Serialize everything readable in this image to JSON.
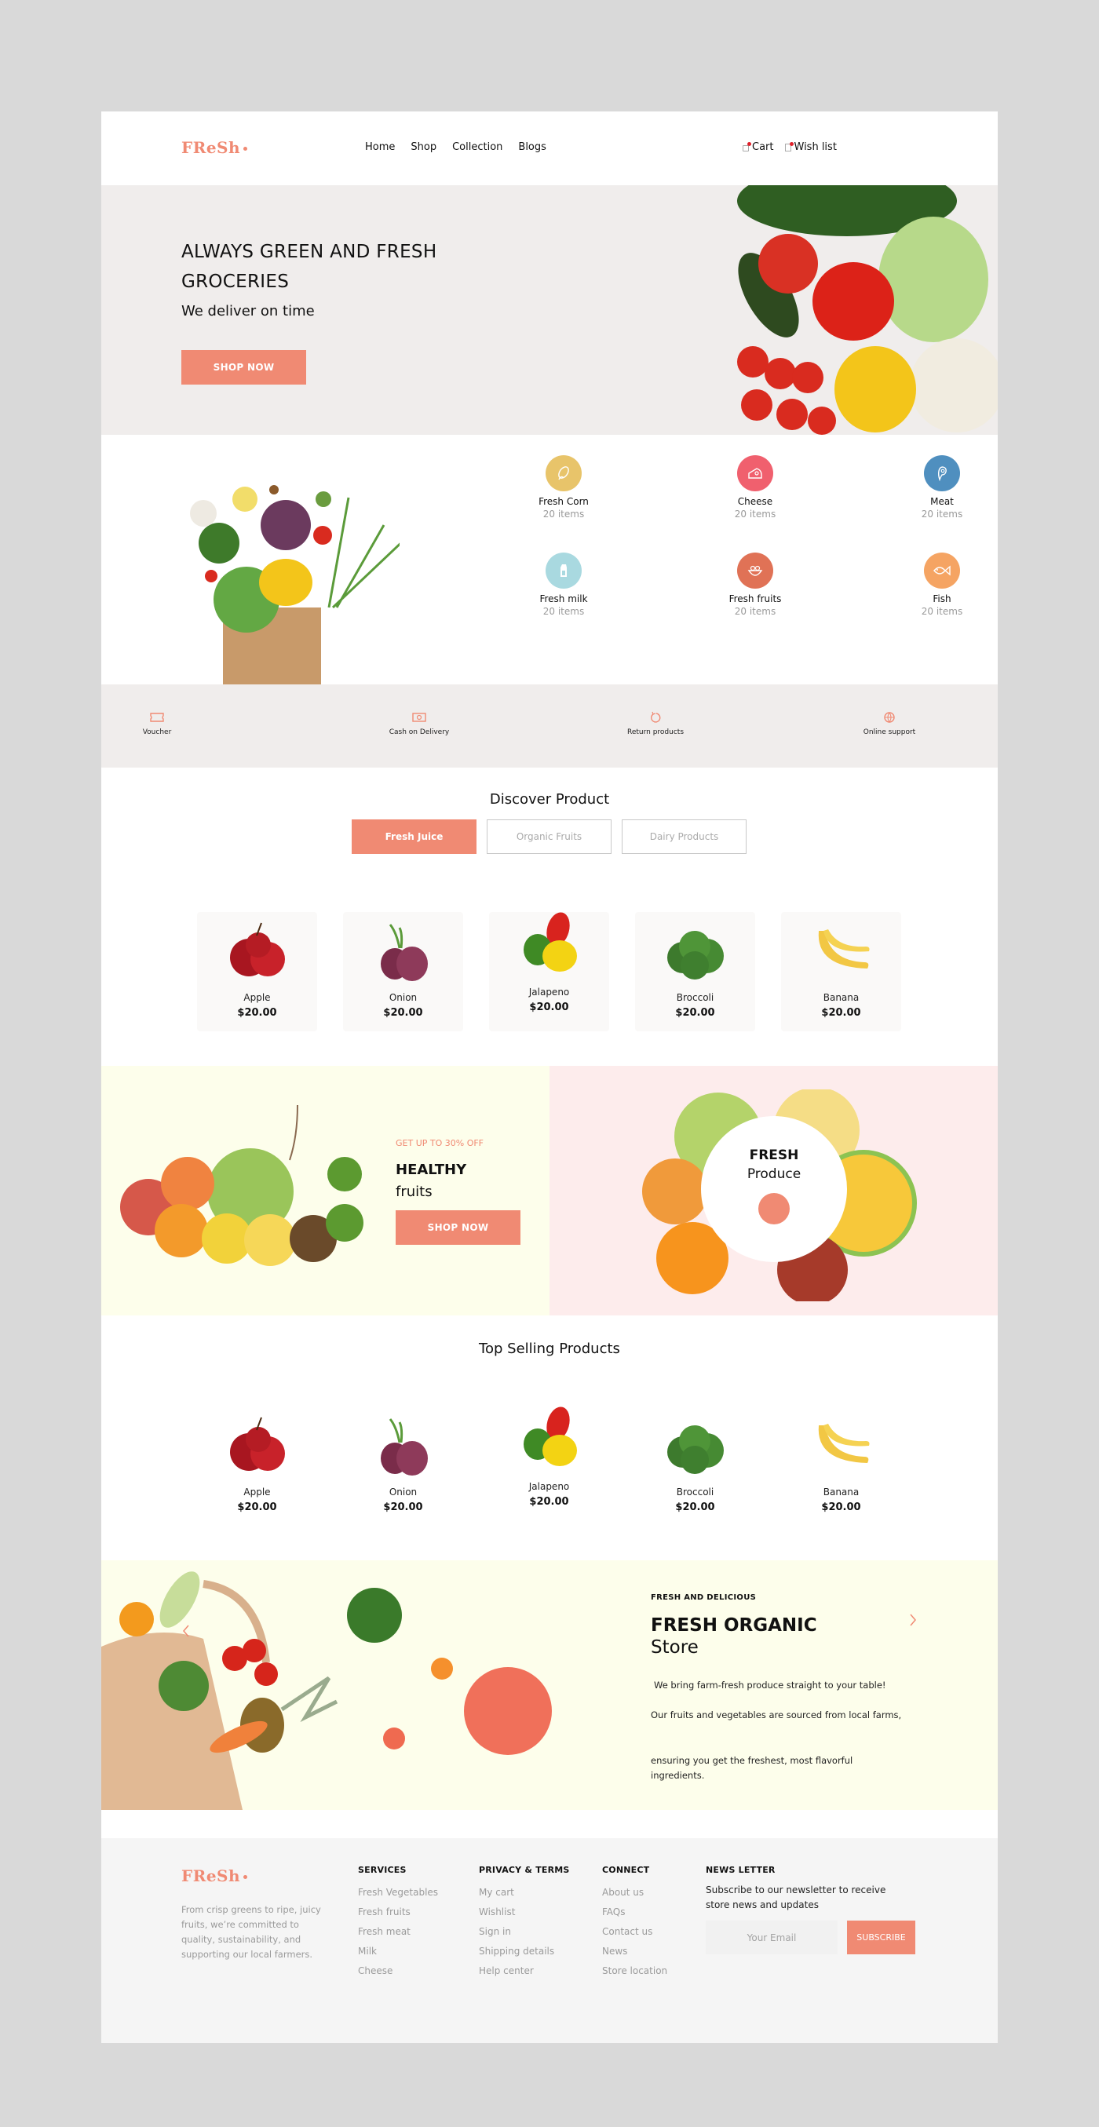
{
  "brand": {
    "logo_text": "FReSh",
    "accent_color": "#f08a73"
  },
  "nav": {
    "links": [
      "Home",
      "Shop",
      "Collection",
      "Blogs"
    ],
    "cart_label": "Cart",
    "wishlist_label": "Wish list"
  },
  "hero": {
    "headline": "ALWAYS GREEN AND FRESH GROCERIES",
    "subheadline": "We deliver on time",
    "cta_label": "SHOP NOW"
  },
  "categories": [
    {
      "name": "Fresh Corn",
      "count": "20 items",
      "icon": "corn-icon",
      "color": "#e8c46a"
    },
    {
      "name": "Cheese",
      "count": "20 items",
      "icon": "cheese-icon",
      "color": "#f0606e"
    },
    {
      "name": "Meat",
      "count": "20 items",
      "icon": "meat-icon",
      "color": "#4f8fbf"
    },
    {
      "name": "Fresh milk",
      "count": "20 items",
      "icon": "milk-icon",
      "color": "#a9d9e0"
    },
    {
      "name": "Fresh fruits",
      "count": "20 items",
      "icon": "fruit-bowl-icon",
      "color": "#e07256"
    },
    {
      "name": "Fish",
      "count": "20 items",
      "icon": "fish-icon",
      "color": "#f5a463"
    }
  ],
  "features": [
    {
      "label": "Voucher",
      "icon": "voucher-icon"
    },
    {
      "label": "Cash on Delivery",
      "icon": "cash-icon"
    },
    {
      "label": "Return products",
      "icon": "return-icon"
    },
    {
      "label": "Online support",
      "icon": "globe-icon"
    }
  ],
  "discover": {
    "title": "Discover Product",
    "tabs": [
      {
        "label": "Fresh Juice",
        "active": true
      },
      {
        "label": "Organic Fruits",
        "active": false
      },
      {
        "label": "Dairy Products",
        "active": false
      }
    ],
    "products": [
      {
        "name": "Apple",
        "price": "$20.00"
      },
      {
        "name": "Onion",
        "price": "$20.00"
      },
      {
        "name": "Jalapeno",
        "price": "$20.00"
      },
      {
        "name": "Broccoli",
        "price": "$20.00"
      },
      {
        "name": "Banana",
        "price": "$20.00"
      }
    ]
  },
  "promo": {
    "tag": "GET UP TO 30% OFF",
    "title_bold": "HEALTHY",
    "title_light": "fruits",
    "cta_label": "SHOP NOW",
    "circle_bold": "FRESH",
    "circle_light": "Produce"
  },
  "top_selling": {
    "title": "Top Selling Products",
    "products": [
      {
        "name": "Apple",
        "price": "$20.00"
      },
      {
        "name": "Onion",
        "price": "$20.00"
      },
      {
        "name": "Jalapeno",
        "price": "$20.00"
      },
      {
        "name": "Broccoli",
        "price": "$20.00"
      },
      {
        "name": "Banana",
        "price": "$20.00"
      }
    ]
  },
  "store": {
    "kicker": "FRESH AND  DELICIOUS",
    "title_bold": "FRESH ORGANIC",
    "title_light": "Store",
    "p1": "We bring farm-fresh produce straight to your table!",
    "p2": "Our fruits and vegetables are sourced from local farms,",
    "p3": "ensuring you get the freshest, most flavorful ingredients."
  },
  "footer": {
    "about": "From crisp greens to ripe, juicy fruits, we’re committed to quality, sustainability, and supporting our local farmers.",
    "services": {
      "title": "SERVICES",
      "links": [
        "Fresh Vegetables",
        "Fresh fruits",
        "Fresh meat",
        "Milk",
        "Cheese"
      ]
    },
    "privacy": {
      "title": "PRIVACY & TERMS",
      "links": [
        "My cart",
        "Wishlist",
        "Sign in",
        "Shipping details",
        "Help center"
      ]
    },
    "connect": {
      "title": "CONNECT",
      "links": [
        "About us",
        "FAQs",
        "Contact us",
        "News",
        "Store location"
      ]
    },
    "newsletter": {
      "title": "NEWS LETTER",
      "text": "Subscribe to our newsletter to receive store news and updates",
      "email_placeholder": "Your Email",
      "button_label": "SUBSCRIBE"
    }
  }
}
